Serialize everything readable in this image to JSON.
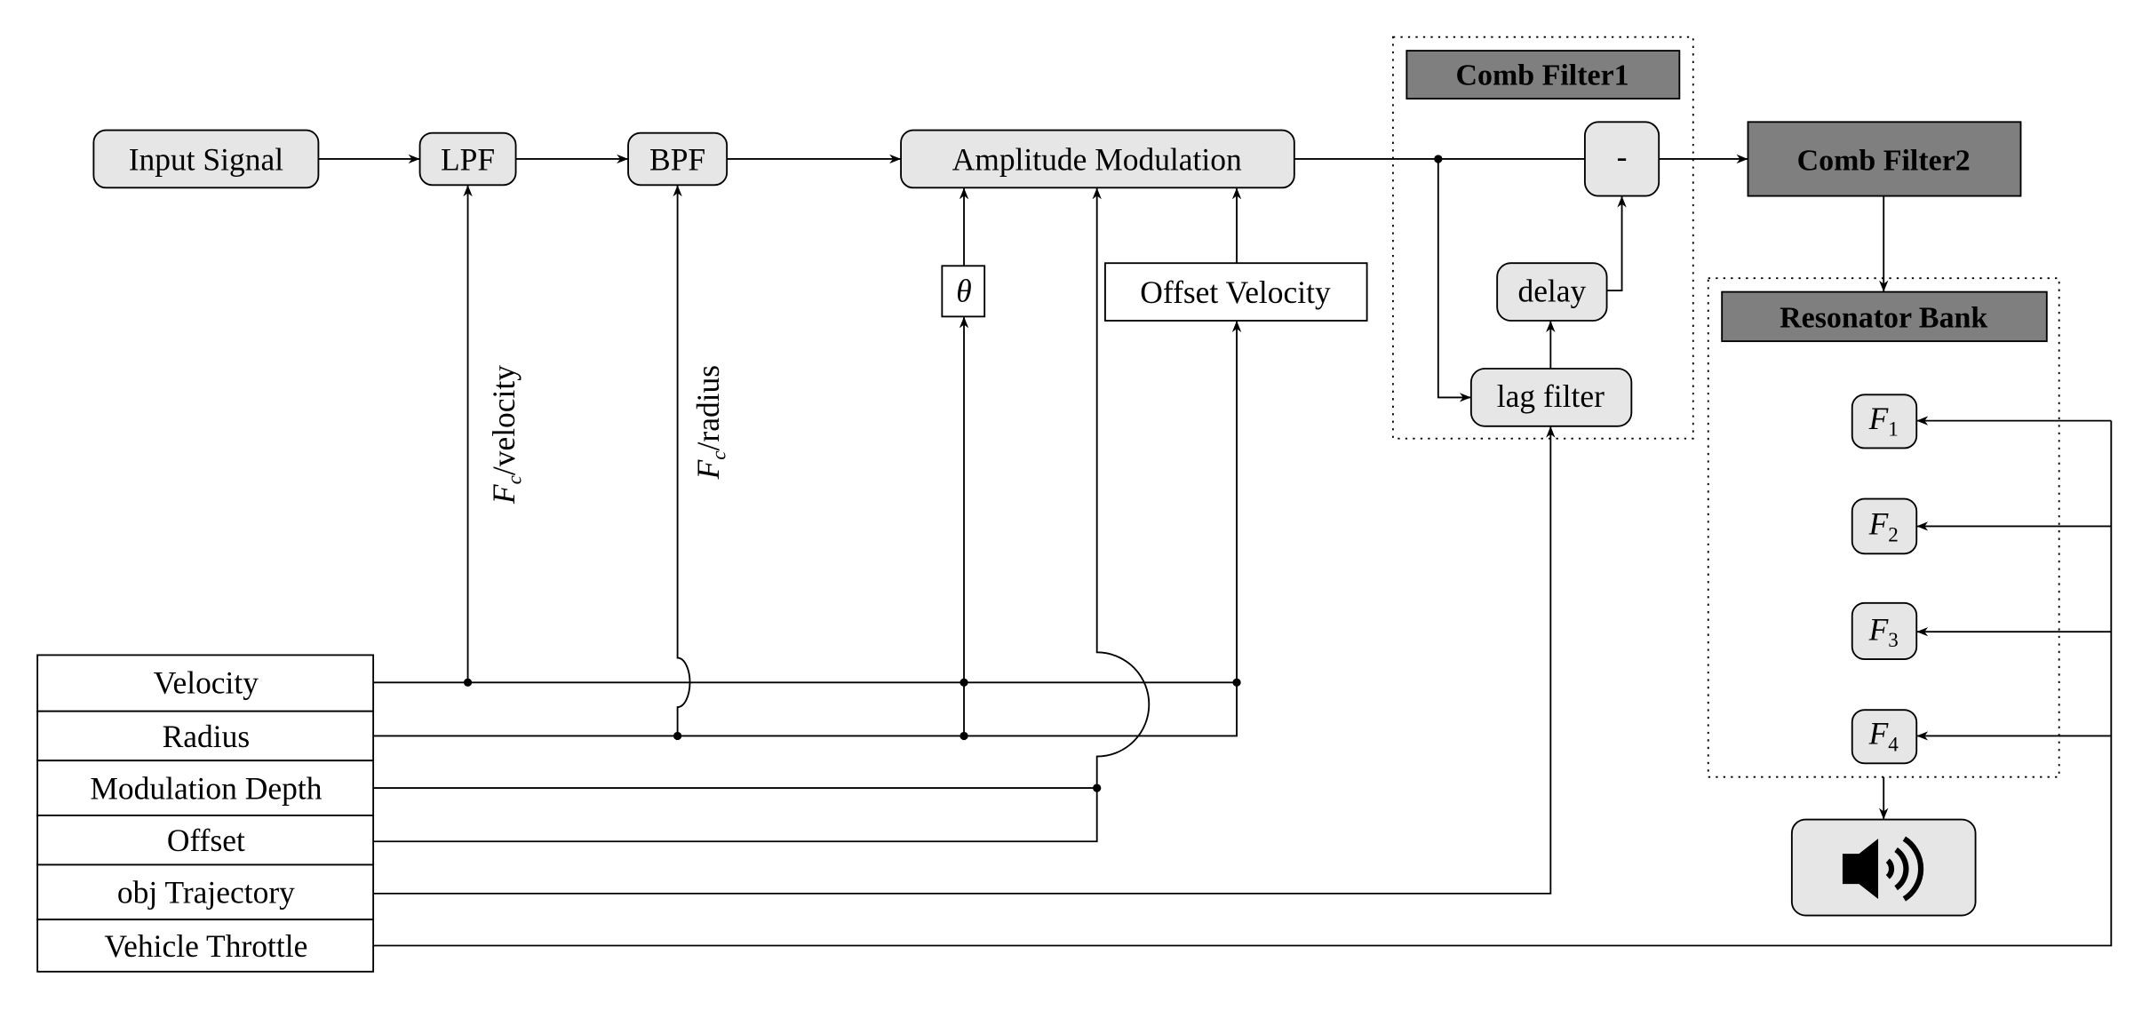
{
  "blocks": {
    "input_signal": "Input Signal",
    "lpf": "LPF",
    "bpf": "BPF",
    "amplitude_modulation": "Amplitude Modulation",
    "theta": "θ",
    "offset_velocity": "Offset Velocity",
    "comb_filter1": "Comb Filter1",
    "subtract": "-",
    "delay": "delay",
    "lag_filter": "lag filter",
    "comb_filter2": "Comb Filter2",
    "resonator_bank": "Resonator Bank",
    "resonators": [
      {
        "symbol": "F",
        "sub": "1"
      },
      {
        "symbol": "F",
        "sub": "2"
      },
      {
        "symbol": "F",
        "sub": "3"
      },
      {
        "symbol": "F",
        "sub": "4"
      }
    ],
    "output_icon": "speaker-icon"
  },
  "edge_labels": {
    "lpf_control": {
      "symbol": "F",
      "sub": "c",
      "rest": "/velocity"
    },
    "bpf_control": {
      "symbol": "F",
      "sub": "c",
      "rest": "/radius"
    }
  },
  "parameters": [
    "Velocity",
    "Radius",
    "Modulation Depth",
    "Offset",
    "obj Trajectory",
    "Vehicle Throttle"
  ],
  "colors": {
    "block_fill": "#e6e6e6",
    "header_fill": "#7f7f7f"
  }
}
